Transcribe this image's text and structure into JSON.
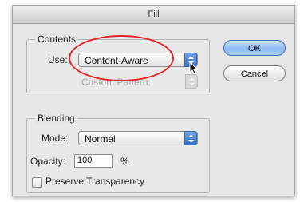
{
  "dialog": {
    "title": "Fill"
  },
  "contents": {
    "legend": "Contents",
    "use_label": "Use:",
    "use_value": "Content-Aware",
    "custom_pattern_label": "Custom Pattern:"
  },
  "blending": {
    "legend": "Blending",
    "mode_label": "Mode:",
    "mode_value": "Normal",
    "opacity_label": "Opacity:",
    "opacity_value": "100",
    "opacity_unit": "%",
    "preserve_label": "Preserve Transparency",
    "preserve_checked": false
  },
  "buttons": {
    "ok": "OK",
    "cancel": "Cancel"
  },
  "colors": {
    "highlight": "#e3262a",
    "default_button": "#8bb9ef"
  },
  "icons": {
    "popup_arrows": "updown-arrows-icon",
    "cursor": "mouse-pointer-icon"
  }
}
